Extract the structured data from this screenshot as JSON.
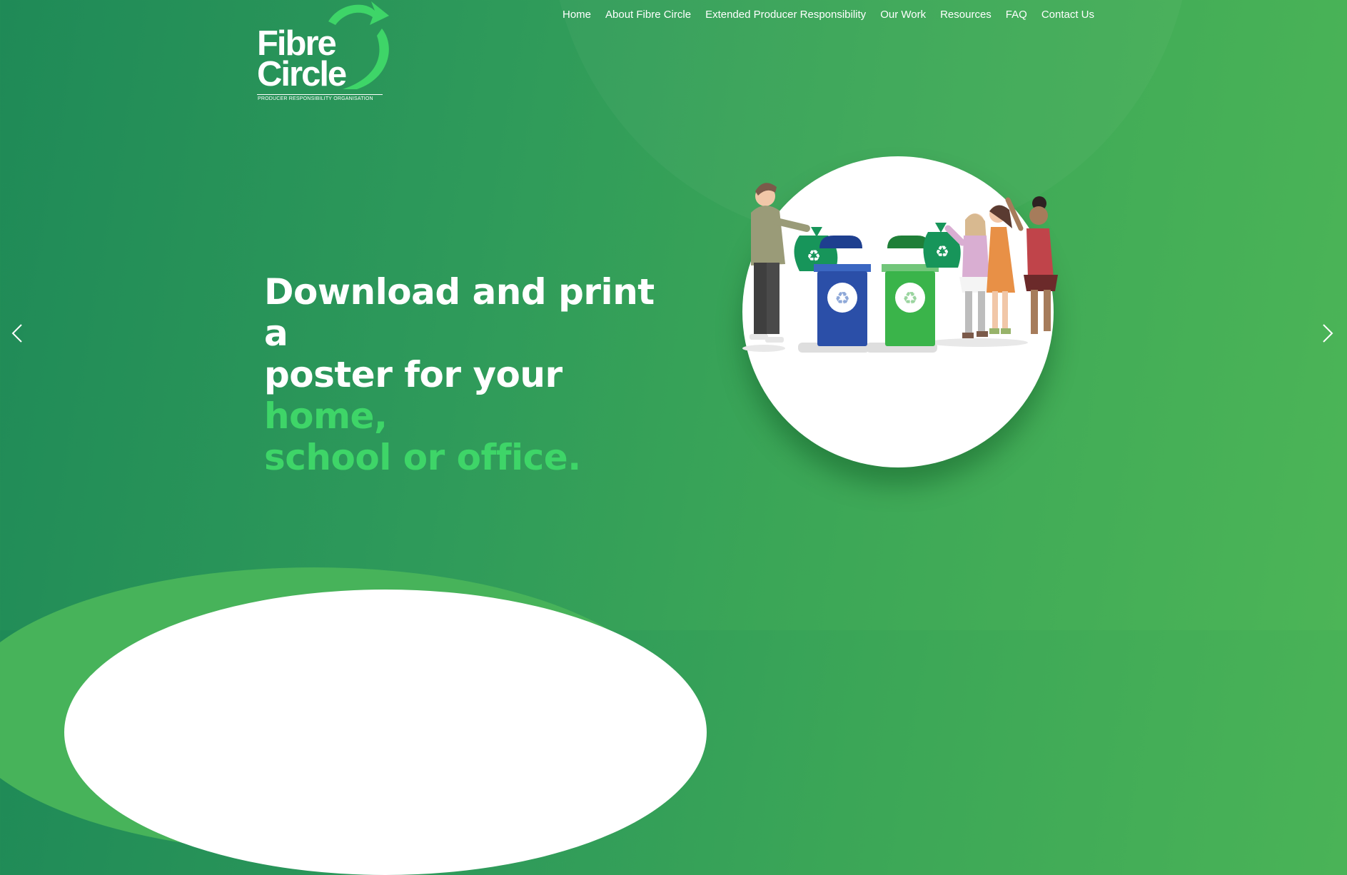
{
  "brand": {
    "name_line1": "Fibre",
    "name_line2": "Circle",
    "tagline": "PRODUCER RESPONSIBILITY ORGANISATION"
  },
  "nav": {
    "items": [
      {
        "label": "Home"
      },
      {
        "label": "About Fibre Circle"
      },
      {
        "label": "Extended Producer Responsibility"
      },
      {
        "label": "Our Work"
      },
      {
        "label": "Resources"
      },
      {
        "label": "FAQ"
      },
      {
        "label": "Contact Us"
      }
    ]
  },
  "hero": {
    "line1": "Download and print a",
    "line2_plain": "poster for your ",
    "line2_accent": "home,",
    "line3_accent": "school or office."
  },
  "slider": {
    "prev_icon": "chevron-left-icon",
    "next_icon": "chevron-right-icon"
  },
  "colors": {
    "accent_green": "#3ed568",
    "bin_blue": "#2b4fa8",
    "bin_green": "#3ab44a",
    "bag_green": "#17955a"
  }
}
